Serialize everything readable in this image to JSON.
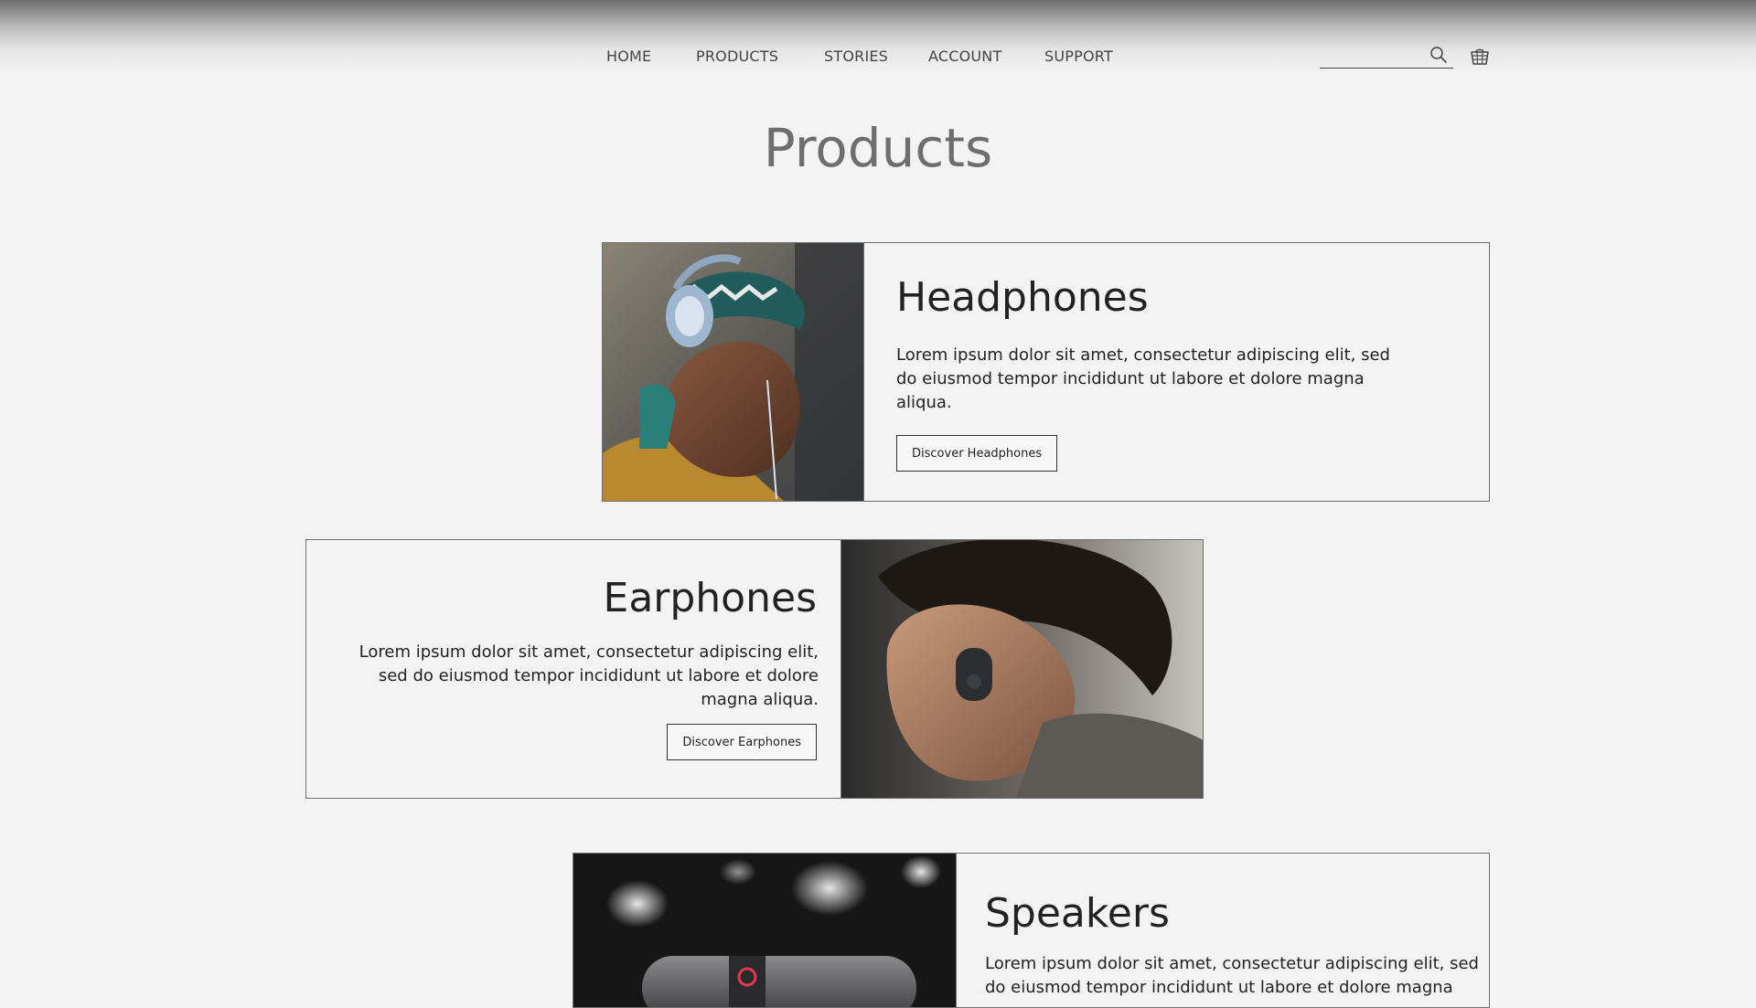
{
  "nav": {
    "items": [
      {
        "label": "HOME"
      },
      {
        "label": "PRODUCTS"
      },
      {
        "label": "STORIES"
      },
      {
        "label": "ACCOUNT"
      },
      {
        "label": "SUPPORT"
      }
    ]
  },
  "search": {
    "placeholder": "",
    "value": "",
    "icon": "search-icon"
  },
  "cart": {
    "icon": "cart-icon"
  },
  "page": {
    "title": "Products"
  },
  "products": [
    {
      "heading": "Headphones",
      "description": "Lorem ipsum dolor sit amet, consectetur adipiscing elit, sed do eiusmod tempor incididunt ut labore et dolore magna aliqua.",
      "button_label": "Discover Headphones",
      "image": "person-with-headphones-photo"
    },
    {
      "heading": "Earphones",
      "description": "Lorem ipsum dolor sit amet, consectetur adipiscing elit, sed do eiusmod tempor incididunt ut labore et dolore magna aliqua.",
      "button_label": "Discover Earphones",
      "image": "person-with-earphone-photo"
    },
    {
      "heading": "Speakers",
      "description": "Lorem ipsum dolor sit amet, consectetur adipiscing elit, sed do eiusmod tempor incididunt ut labore et dolore magna",
      "image": "speaker-photo"
    }
  ],
  "colors": {
    "background": "#f3f3f3",
    "border": "#6f6f6f",
    "title": "#6e6e6e",
    "text": "#222222"
  }
}
